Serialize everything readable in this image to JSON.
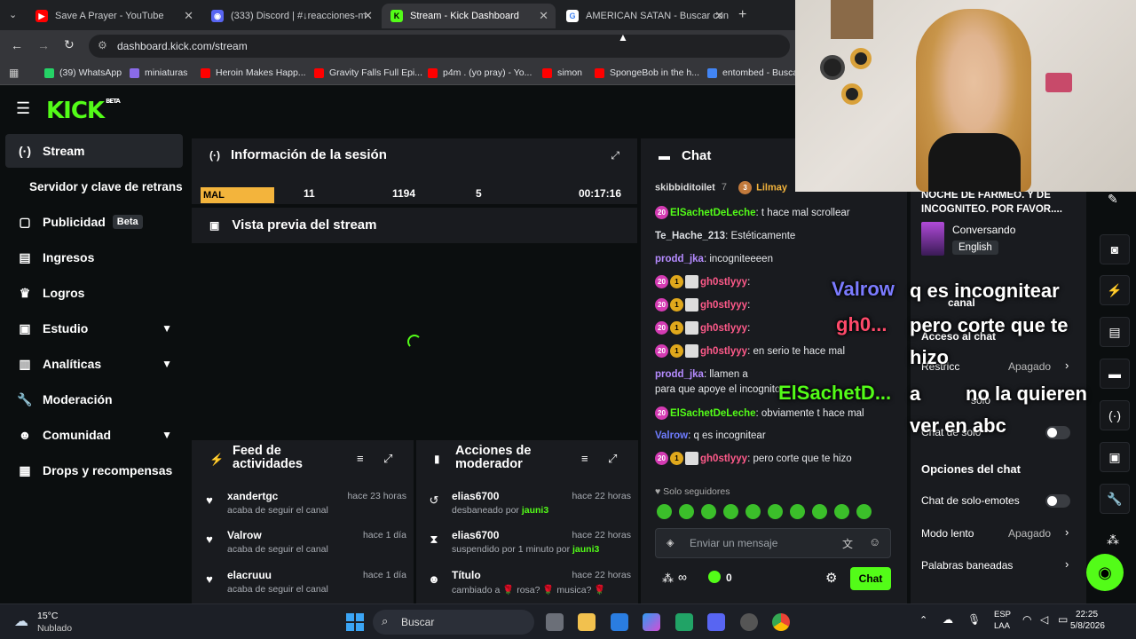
{
  "browser": {
    "tabs": [
      {
        "title": "Save A Prayer - YouTube"
      },
      {
        "title": "(333) Discord | #↓reacciones-m"
      },
      {
        "title": "Stream - Kick Dashboard"
      },
      {
        "title": "AMERICAN SATAN - Buscar con"
      }
    ],
    "url": "dashboard.kick.com/stream",
    "bookmarks": [
      {
        "label": "(39) WhatsApp",
        "color": "#25d366"
      },
      {
        "label": "miniaturas",
        "color": "#8a6be8"
      },
      {
        "label": "Heroin Makes Happ...",
        "color": "#ff0000"
      },
      {
        "label": "Gravity Falls Full Epi...",
        "color": "#ff0000"
      },
      {
        "label": "p4m . (yo pray) - Yo...",
        "color": "#ff0000"
      },
      {
        "label": "simon",
        "color": "#ff0000"
      },
      {
        "label": "SpongeBob in the h...",
        "color": "#ff0000"
      },
      {
        "label": "entombed - Busca",
        "color": "#4285f4"
      }
    ]
  },
  "kick": {
    "logo": "KICK",
    "logo_sup": "BETA",
    "accent": "#53fc18"
  },
  "sidebar": {
    "items": [
      {
        "label": "Stream",
        "icon": "broadcast-icon"
      },
      {
        "label": "Servidor y clave de retransm"
      },
      {
        "label": "Publicidad",
        "badge": "Beta",
        "icon": "ad-icon"
      },
      {
        "label": "Ingresos",
        "icon": "revenue-icon"
      },
      {
        "label": "Logros",
        "icon": "trophy-icon"
      },
      {
        "label": "Estudio",
        "icon": "studio-icon"
      },
      {
        "label": "Analíticas",
        "icon": "analytics-icon"
      },
      {
        "label": "Moderación",
        "icon": "wrench-icon"
      },
      {
        "label": "Comunidad",
        "icon": "community-icon"
      },
      {
        "label": "Drops y recompensas",
        "icon": "gift-icon"
      }
    ]
  },
  "session": {
    "title": "Información de la sesión",
    "stats": [
      "MAL",
      "11",
      "1194",
      "5",
      "00:17:16"
    ]
  },
  "preview": {
    "title": "Vista previa del stream"
  },
  "feed": {
    "title_line1": "Feed de",
    "title_line2": "actividades",
    "rows": [
      {
        "name": "xandertgc",
        "action": "acaba de seguir el canal",
        "time": "hace 23 horas"
      },
      {
        "name": "Valrow",
        "action": "acaba de seguir el canal",
        "time": "hace 1 día"
      },
      {
        "name": "elacruuu",
        "action": "acaba de seguir el canal",
        "time": "hace 1 día"
      }
    ]
  },
  "mod": {
    "title_line1": "Acciones de",
    "title_line2": "moderador",
    "rows": [
      {
        "name": "elias6700",
        "action_pre": "desbaneado por ",
        "actor": "jauni3",
        "time": "hace 22 horas"
      },
      {
        "name": "elias6700",
        "action_pre": "suspendido por 1 minuto por ",
        "actor": "jauni3",
        "time": "hace 22 horas"
      },
      {
        "name": "Título",
        "action_pre": "cambiado a 🌹 rosa? 🌹 musica? 🌹",
        "actor": "",
        "time": "hace 22 horas"
      }
    ]
  },
  "chat": {
    "title": "Chat",
    "top_users": [
      {
        "name": "skibbiditoilet",
        "count": "7"
      },
      {
        "name": "Lilmay",
        "count": "3"
      }
    ],
    "messages": [
      {
        "badges": [
          "20"
        ],
        "user": "ElSachetDeLeche",
        "color": "#53fc18",
        "text": ": t hace mal scrollear"
      },
      {
        "badges": [],
        "user": "Te_Hache_213",
        "color": "#dcdfe3",
        "text": ": Estéticamente"
      },
      {
        "badges": [],
        "user": "prodd_jka",
        "color": "#b58bff",
        "text": ": incogniteeeen"
      },
      {
        "badges": [
          "20",
          "1"
        ],
        "user": "gh0stlyyy",
        "color": "#ff5a8a",
        "text": ":"
      },
      {
        "badges": [
          "20",
          "1"
        ],
        "user": "gh0stlyyy",
        "color": "#ff5a8a",
        "text": ":"
      },
      {
        "badges": [
          "20",
          "1"
        ],
        "user": "gh0stlyyy",
        "color": "#ff5a8a",
        "text": ":"
      },
      {
        "badges": [
          "20",
          "1"
        ],
        "user": "gh0stlyyy",
        "color": "#ff5a8a",
        "text": ": en serio te hace mal"
      },
      {
        "badges": [],
        "user": "prodd_jka",
        "color": "#b58bff",
        "text": ": llamen a"
      },
      {
        "badges": [],
        "user": "",
        "color": "#e5e7ea",
        "text": "para que apoye el incognito"
      },
      {
        "badges": [
          "20"
        ],
        "user": "ElSachetDeLeche",
        "color": "#53fc18",
        "text": ": obviamente t hace mal"
      },
      {
        "badges": [],
        "user": "Valrow",
        "color": "#6e7cff",
        "text": ": q es incognitear"
      },
      {
        "badges": [
          "20",
          "1"
        ],
        "user": "gh0stlyyy",
        "color": "#ff5a8a",
        "text": ": pero corte que te hizo"
      }
    ],
    "followers_only": "Solo seguidores",
    "input_placeholder": "Enviar un mensaje",
    "count": "0",
    "send_label": "Chat"
  },
  "overlay": {
    "valrow": "Valrow",
    "gh0": "gh0...",
    "sachet": "ElSachetD...",
    "line1": "q es incognitear",
    "line2": "pero corte que te",
    "line3": "hizo",
    "line4": "a",
    "line5": "no la quieren",
    "line6": "ver en abc"
  },
  "settings": {
    "title_text": "NOCHE DE FARMEO. Y DE INCOGNITEO. POR FAVOR....",
    "category": "Conversando",
    "language": "English",
    "canal": "canal",
    "access": "Acceso al chat",
    "restrict": "Restricc",
    "apagado1": "Apagado",
    "solo": "solo",
    "chat_solo": "Chat de solo",
    "options_title": "Opciones del chat",
    "emotes_only": "Chat de solo-emotes",
    "slow_mode": "Modo lento",
    "slow_value": "Apagado",
    "banned_words": "Palabras baneadas"
  },
  "taskbar": {
    "temp": "15°C",
    "weather": "Nublado",
    "search": "Buscar",
    "lang1": "ESP",
    "lang2": "LAA",
    "time": "22:25",
    "date": "5/8/2026"
  }
}
